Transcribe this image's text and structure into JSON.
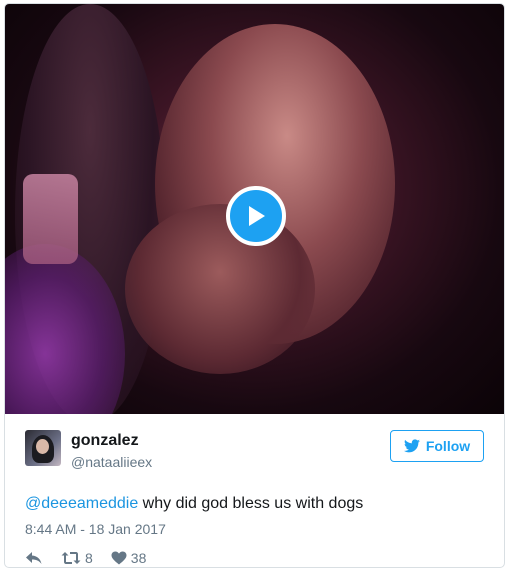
{
  "tweet": {
    "author": {
      "display_name": "gonzalez",
      "screen_name": "@nataaliieex"
    },
    "follow_label": "Follow",
    "text": {
      "mention": "@deeeameddie",
      "body": " why did god bless us with dogs"
    },
    "timestamp": "8:44 AM - 18 Jan 2017",
    "actions": {
      "retweet_count": "8",
      "like_count": "38"
    }
  },
  "icons": {
    "play": "play-icon",
    "twitter": "twitter-bird-icon",
    "reply": "reply-icon",
    "retweet": "retweet-icon",
    "like": "heart-icon"
  },
  "colors": {
    "accent": "#1da1f2",
    "mention": "#1b95e0",
    "text": "#14171a",
    "muted": "#657786"
  }
}
